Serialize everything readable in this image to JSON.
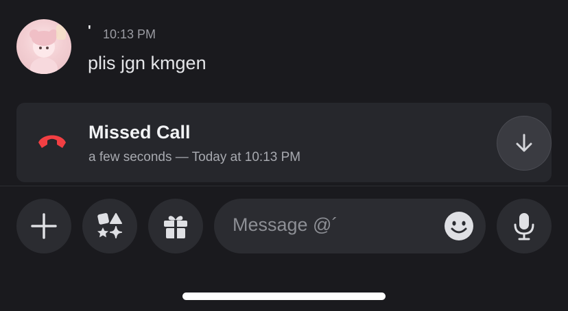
{
  "message": {
    "username": "'",
    "timestamp": "10:13 PM",
    "text": "plis jgn kmgen"
  },
  "call": {
    "title": "Missed Call",
    "subtitle": "a few seconds — Today at 10:13 PM",
    "icon": "phone-hangup-icon",
    "icon_color": "#f23f43"
  },
  "input": {
    "placeholder": "Message @´"
  },
  "icons": {
    "add": "plus-icon",
    "apps": "apps-icon",
    "gift": "gift-icon",
    "emoji": "emoji-icon",
    "mic": "microphone-icon",
    "jump": "arrow-down-icon"
  },
  "colors": {
    "background": "#1a1a1e",
    "card": "#26272c",
    "button": "#2b2c31",
    "icon": "#dfe0e4"
  }
}
